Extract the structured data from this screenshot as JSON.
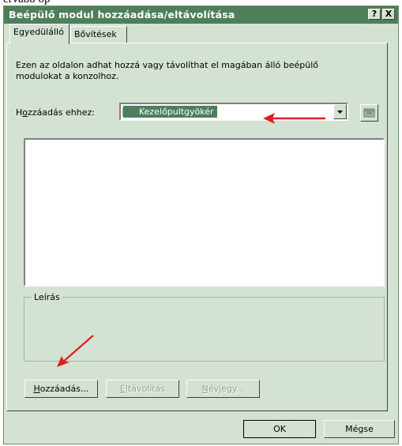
{
  "top_fragment": "ervabb op",
  "window": {
    "title": "Beépülő modul hozzáadása/eltávolítása",
    "help_button": "?",
    "close_button": "X"
  },
  "tabs": [
    {
      "label": "Egyedülálló",
      "active": true
    },
    {
      "label": "Bővítések",
      "active": false
    }
  ],
  "description": "Ezen az oldalon adhat hozzá vagy távolíthat el magában álló beépülő modulokat a konzolhoz.",
  "add_to": {
    "label_prefix": "H",
    "label_underlined": "o",
    "label_suffix": "zzáadás ehhez:",
    "selected_value": "Kezelőpultgyökér"
  },
  "snapin_list": [],
  "description_group": {
    "label": "Leírás",
    "text": ""
  },
  "action_buttons": {
    "add": {
      "underlined": "H",
      "rest": "ozzáadás...",
      "enabled": true
    },
    "remove": {
      "underlined": "E",
      "rest": "ltávolítás",
      "enabled": false
    },
    "about": {
      "underlined": "N",
      "rest": "évjegy...",
      "enabled": false
    }
  },
  "dialog_buttons": {
    "ok": "OK",
    "cancel": "Mégse"
  },
  "colors": {
    "title_bar": "#4f7f5a",
    "dialog_bg": "#d4e2d4",
    "selection": "#4e7f5c",
    "annotation_arrow": "#e02020"
  }
}
